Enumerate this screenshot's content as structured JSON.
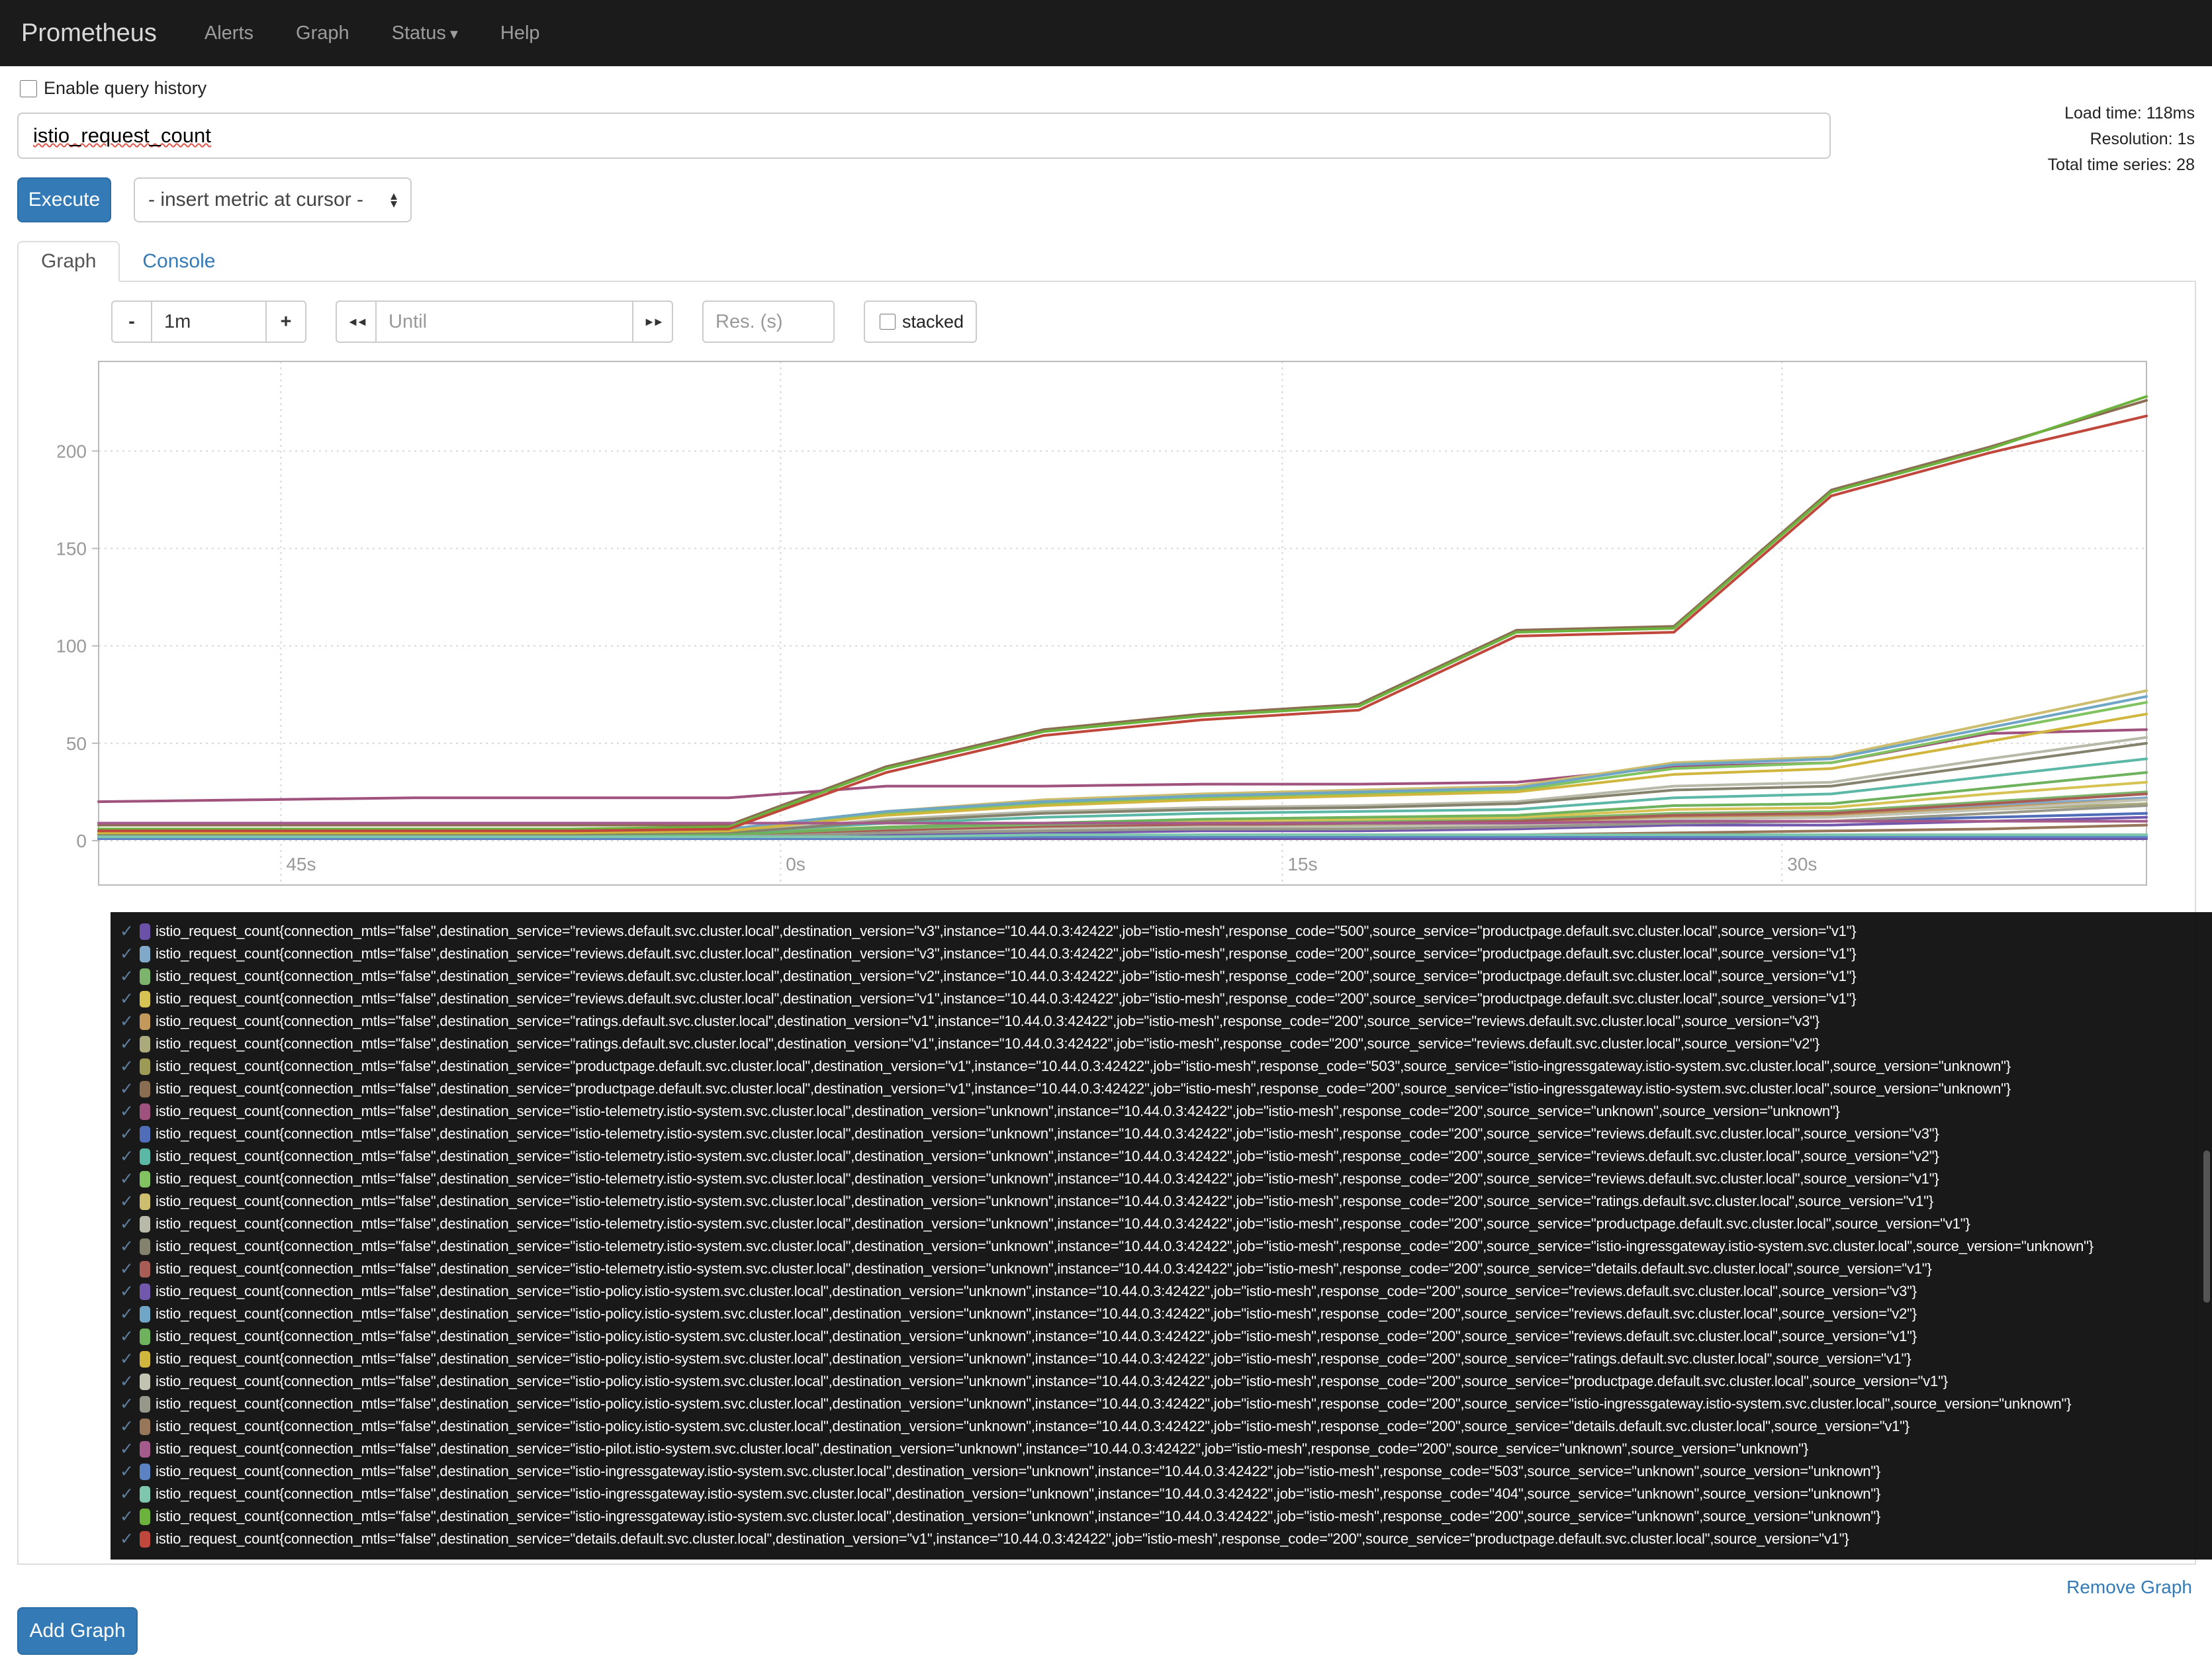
{
  "navbar": {
    "brand": "Prometheus",
    "items": [
      {
        "label": "Alerts"
      },
      {
        "label": "Graph"
      },
      {
        "label": "Status",
        "caret": "▾"
      },
      {
        "label": "Help"
      }
    ]
  },
  "query": {
    "history_label": "Enable query history",
    "expression": "istio_request_count",
    "execute_label": "Execute",
    "metric_select_label": "- insert metric at cursor -",
    "stats": {
      "load_time": "Load time: 118ms",
      "resolution": "Resolution: 1s",
      "total_series": "Total time series: 28"
    }
  },
  "tabs": {
    "graph": "Graph",
    "console": "Console"
  },
  "controls": {
    "minus": "-",
    "duration": "1m",
    "plus": "+",
    "back_icon": "◄◄",
    "until_placeholder": "Until",
    "forward_icon": "►►",
    "res_placeholder": "Res. (s)",
    "stacked_label": "stacked"
  },
  "icons": {
    "check": "✓",
    "select_up": "▴",
    "select_down": "▾"
  },
  "footer": {
    "remove_graph": "Remove Graph",
    "add_graph": "Add Graph"
  },
  "chart_data": {
    "type": "line",
    "x_ticks": [
      {
        "pos": 0.089,
        "label": "45s"
      },
      {
        "pos": 0.333,
        "label": "0s"
      },
      {
        "pos": 0.578,
        "label": "15s"
      },
      {
        "pos": 0.822,
        "label": "30s"
      }
    ],
    "y_ticks": [
      0,
      50,
      100,
      150,
      200
    ],
    "ylim": [
      0,
      246
    ],
    "grid": true,
    "legend_position": "below",
    "series": [
      {
        "name": "reviews-v3-500-from-productpage",
        "color": "#6b51a7",
        "values": [
          1,
          1,
          1,
          1,
          1,
          1,
          1,
          1,
          1,
          1,
          1,
          1,
          1,
          1
        ],
        "label": "istio_request_count{connection_mtls=\"false\",destination_service=\"reviews.default.svc.cluster.local\",destination_version=\"v3\",instance=\"10.44.0.3:42422\",job=\"istio-mesh\",response_code=\"500\",source_service=\"productpage.default.svc.cluster.local\",source_version=\"v1\"}"
      },
      {
        "name": "reviews-v3-200-from-productpage",
        "color": "#7fa8c9",
        "values": [
          2,
          2,
          2,
          2,
          3,
          6,
          7,
          8,
          9,
          10,
          13,
          14,
          18,
          22
        ],
        "label": "istio_request_count{connection_mtls=\"false\",destination_service=\"reviews.default.svc.cluster.local\",destination_version=\"v3\",instance=\"10.44.0.3:42422\",job=\"istio-mesh\",response_code=\"200\",source_service=\"productpage.default.svc.cluster.local\",source_version=\"v1\"}"
      },
      {
        "name": "reviews-v2-200-from-productpage",
        "color": "#7db46c",
        "values": [
          2,
          2,
          2,
          2,
          3,
          6,
          8,
          9,
          10,
          11,
          14,
          15,
          20,
          25
        ],
        "label": "istio_request_count{connection_mtls=\"false\",destination_service=\"reviews.default.svc.cluster.local\",destination_version=\"v2\",instance=\"10.44.0.3:42422\",job=\"istio-mesh\",response_code=\"200\",source_service=\"productpage.default.svc.cluster.local\",source_version=\"v1\"}"
      },
      {
        "name": "reviews-v1-200-from-productpage",
        "color": "#d6c354",
        "values": [
          3,
          3,
          3,
          3,
          4,
          7,
          9,
          10,
          11,
          12,
          16,
          17,
          24,
          30
        ],
        "label": "istio_request_count{connection_mtls=\"false\",destination_service=\"reviews.default.svc.cluster.local\",destination_version=\"v1\",instance=\"10.44.0.3:42422\",job=\"istio-mesh\",response_code=\"200\",source_service=\"productpage.default.svc.cluster.local\",source_version=\"v1\"}"
      },
      {
        "name": "ratings-v1-200-from-reviews-v3",
        "color": "#c2995b",
        "values": [
          2,
          2,
          2,
          2,
          2,
          5,
          7,
          8,
          8,
          9,
          12,
          13,
          17,
          21
        ],
        "label": "istio_request_count{connection_mtls=\"false\",destination_service=\"ratings.default.svc.cluster.local\",destination_version=\"v1\",instance=\"10.44.0.3:42422\",job=\"istio-mesh\",response_code=\"200\",source_service=\"reviews.default.svc.cluster.local\",source_version=\"v3\"}"
      },
      {
        "name": "ratings-v1-200-from-reviews-v2",
        "color": "#abaa7d",
        "values": [
          2,
          2,
          2,
          2,
          2,
          4,
          6,
          7,
          8,
          8,
          11,
          12,
          16,
          19
        ],
        "label": "istio_request_count{connection_mtls=\"false\",destination_service=\"ratings.default.svc.cluster.local\",destination_version=\"v1\",instance=\"10.44.0.3:42422\",job=\"istio-mesh\",response_code=\"200\",source_service=\"reviews.default.svc.cluster.local\",source_version=\"v2\"}"
      },
      {
        "name": "productpage-503-from-ingressgateway",
        "color": "#9c9a55",
        "values": [
          1,
          1,
          1,
          1,
          1,
          2,
          2,
          2,
          2,
          2,
          3,
          3,
          3,
          3
        ],
        "label": "istio_request_count{connection_mtls=\"false\",destination_service=\"productpage.default.svc.cluster.local\",destination_version=\"v1\",instance=\"10.44.0.3:42422\",job=\"istio-mesh\",response_code=\"503\",source_service=\"istio-ingressgateway.istio-system.svc.cluster.local\",source_version=\"unknown\"}"
      },
      {
        "name": "productpage-200-from-ingressgateway",
        "color": "#8b6d51",
        "values": [
          8,
          8,
          8,
          8,
          8,
          38,
          57,
          65,
          70,
          108,
          110,
          180,
          202,
          226
        ],
        "label": "istio_request_count{connection_mtls=\"false\",destination_service=\"productpage.default.svc.cluster.local\",destination_version=\"v1\",instance=\"10.44.0.3:42422\",job=\"istio-mesh\",response_code=\"200\",source_service=\"istio-ingressgateway.istio-system.svc.cluster.local\",source_version=\"unknown\"}"
      },
      {
        "name": "telemetry-200-from-unknown",
        "color": "#a0527e",
        "values": [
          20,
          21,
          22,
          22,
          22,
          28,
          28,
          29,
          29,
          30,
          38,
          40,
          55,
          57
        ],
        "label": "istio_request_count{connection_mtls=\"false\",destination_service=\"istio-telemetry.istio-system.svc.cluster.local\",destination_version=\"unknown\",instance=\"10.44.0.3:42422\",job=\"istio-mesh\",response_code=\"200\",source_service=\"unknown\",source_version=\"unknown\"}"
      },
      {
        "name": "telemetry-200-from-reviews-v3",
        "color": "#4f6db8",
        "values": [
          1,
          1,
          1,
          1,
          2,
          4,
          5,
          6,
          6,
          7,
          9,
          10,
          12,
          14
        ],
        "label": "istio_request_count{connection_mtls=\"false\",destination_service=\"istio-telemetry.istio-system.svc.cluster.local\",destination_version=\"unknown\",instance=\"10.44.0.3:42422\",job=\"istio-mesh\",response_code=\"200\",source_service=\"reviews.default.svc.cluster.local\",source_version=\"v3\"}"
      },
      {
        "name": "telemetry-200-from-reviews-v2",
        "color": "#5cb8a6",
        "values": [
          3,
          3,
          3,
          3,
          4,
          9,
          12,
          14,
          15,
          16,
          22,
          24,
          33,
          42
        ],
        "label": "istio_request_count{connection_mtls=\"false\",destination_service=\"istio-telemetry.istio-system.svc.cluster.local\",destination_version=\"unknown\",instance=\"10.44.0.3:42422\",job=\"istio-mesh\",response_code=\"200\",source_service=\"reviews.default.svc.cluster.local\",source_version=\"v2\"}"
      },
      {
        "name": "telemetry-200-from-reviews-v1",
        "color": "#82c361",
        "values": [
          4,
          4,
          4,
          4,
          5,
          14,
          19,
          22,
          24,
          26,
          37,
          40,
          56,
          71
        ],
        "label": "istio_request_count{connection_mtls=\"false\",destination_service=\"istio-telemetry.istio-system.svc.cluster.local\",destination_version=\"unknown\",instance=\"10.44.0.3:42422\",job=\"istio-mesh\",response_code=\"200\",source_service=\"reviews.default.svc.cluster.local\",source_version=\"v1\"}"
      },
      {
        "name": "telemetry-200-from-ratings-v1",
        "color": "#cdbd6e",
        "values": [
          5,
          5,
          5,
          5,
          6,
          15,
          21,
          24,
          26,
          28,
          40,
          43,
          60,
          77
        ],
        "label": "istio_request_count{connection_mtls=\"false\",destination_service=\"istio-telemetry.istio-system.svc.cluster.local\",destination_version=\"unknown\",instance=\"10.44.0.3:42422\",job=\"istio-mesh\",response_code=\"200\",source_service=\"ratings.default.svc.cluster.local\",source_version=\"v1\"}"
      },
      {
        "name": "telemetry-200-from-productpage-v1",
        "color": "#b9b9aa",
        "values": [
          4,
          4,
          4,
          4,
          4,
          11,
          15,
          17,
          18,
          20,
          28,
          30,
          42,
          53
        ],
        "label": "istio_request_count{connection_mtls=\"false\",destination_service=\"istio-telemetry.istio-system.svc.cluster.local\",destination_version=\"unknown\",instance=\"10.44.0.3:42422\",job=\"istio-mesh\",response_code=\"200\",source_service=\"productpage.default.svc.cluster.local\",source_version=\"v1\"}"
      },
      {
        "name": "telemetry-200-from-ingressgateway",
        "color": "#84826c",
        "values": [
          3,
          3,
          3,
          3,
          4,
          10,
          14,
          16,
          17,
          19,
          26,
          28,
          39,
          50
        ],
        "label": "istio_request_count{connection_mtls=\"false\",destination_service=\"istio-telemetry.istio-system.svc.cluster.local\",destination_version=\"unknown\",instance=\"10.44.0.3:42422\",job=\"istio-mesh\",response_code=\"200\",source_service=\"istio-ingressgateway.istio-system.svc.cluster.local\",source_version=\"unknown\"}"
      },
      {
        "name": "telemetry-200-from-details-v1",
        "color": "#a85c56",
        "values": [
          2,
          2,
          2,
          2,
          2,
          5,
          7,
          8,
          9,
          10,
          13,
          14,
          19,
          24
        ],
        "label": "istio_request_count{connection_mtls=\"false\",destination_service=\"istio-telemetry.istio-system.svc.cluster.local\",destination_version=\"unknown\",instance=\"10.44.0.3:42422\",job=\"istio-mesh\",response_code=\"200\",source_service=\"details.default.svc.cluster.local\",source_version=\"v1\"}"
      },
      {
        "name": "policy-200-from-reviews-v3",
        "color": "#7258ad",
        "values": [
          1,
          1,
          1,
          1,
          1,
          3,
          4,
          5,
          5,
          6,
          8,
          8,
          10,
          12
        ],
        "label": "istio_request_count{connection_mtls=\"false\",destination_service=\"istio-policy.istio-system.svc.cluster.local\",destination_version=\"unknown\",instance=\"10.44.0.3:42422\",job=\"istio-mesh\",response_code=\"200\",source_service=\"reviews.default.svc.cluster.local\",source_version=\"v3\"}"
      },
      {
        "name": "policy-200-from-reviews-v2",
        "color": "#6fa6c6",
        "values": [
          5,
          5,
          5,
          5,
          6,
          15,
          20,
          23,
          25,
          27,
          39,
          42,
          58,
          74
        ],
        "label": "istio_request_count{connection_mtls=\"false\",destination_service=\"istio-policy.istio-system.svc.cluster.local\",destination_version=\"unknown\",instance=\"10.44.0.3:42422\",job=\"istio-mesh\",response_code=\"200\",source_service=\"reviews.default.svc.cluster.local\",source_version=\"v2\"}"
      },
      {
        "name": "policy-200-from-reviews-v1",
        "color": "#6fb25e",
        "values": [
          2,
          2,
          2,
          2,
          3,
          7,
          9,
          11,
          12,
          13,
          18,
          19,
          27,
          35
        ],
        "label": "istio_request_count{connection_mtls=\"false\",destination_service=\"istio-policy.istio-system.svc.cluster.local\",destination_version=\"unknown\",instance=\"10.44.0.3:42422\",job=\"istio-mesh\",response_code=\"200\",source_service=\"reviews.default.svc.cluster.local\",source_version=\"v1\"}"
      },
      {
        "name": "policy-200-from-ratings-v1",
        "color": "#d1b63e",
        "values": [
          4,
          4,
          4,
          4,
          5,
          13,
          18,
          21,
          23,
          25,
          34,
          37,
          51,
          65
        ],
        "label": "istio_request_count{connection_mtls=\"false\",destination_service=\"istio-policy.istio-system.svc.cluster.local\",destination_version=\"unknown\",instance=\"10.44.0.3:42422\",job=\"istio-mesh\",response_code=\"200\",source_service=\"ratings.default.svc.cluster.local\",source_version=\"v1\"}"
      },
      {
        "name": "policy-200-from-productpage-v1",
        "color": "#c3c3b4",
        "values": [
          1,
          1,
          1,
          1,
          2,
          4,
          6,
          7,
          7,
          8,
          11,
          12,
          16,
          21
        ],
        "label": "istio_request_count{connection_mtls=\"false\",destination_service=\"istio-policy.istio-system.svc.cluster.local\",destination_version=\"unknown\",instance=\"10.44.0.3:42422\",job=\"istio-mesh\",response_code=\"200\",source_service=\"productpage.default.svc.cluster.local\",source_version=\"v1\"}"
      },
      {
        "name": "policy-200-from-ingressgateway",
        "color": "#98988a",
        "values": [
          1,
          1,
          1,
          1,
          2,
          4,
          5,
          6,
          6,
          7,
          9,
          10,
          14,
          18
        ],
        "label": "istio_request_count{connection_mtls=\"false\",destination_service=\"istio-policy.istio-system.svc.cluster.local\",destination_version=\"unknown\",instance=\"10.44.0.3:42422\",job=\"istio-mesh\",response_code=\"200\",source_service=\"istio-ingressgateway.istio-system.svc.cluster.local\",source_version=\"unknown\"}"
      },
      {
        "name": "policy-200-from-details-v1",
        "color": "#97765a",
        "values": [
          1,
          1,
          1,
          1,
          1,
          2,
          2,
          3,
          3,
          3,
          4,
          5,
          6,
          8
        ],
        "label": "istio_request_count{connection_mtls=\"false\",destination_service=\"istio-policy.istio-system.svc.cluster.local\",destination_version=\"unknown\",instance=\"10.44.0.3:42422\",job=\"istio-mesh\",response_code=\"200\",source_service=\"details.default.svc.cluster.local\",source_version=\"v1\"}"
      },
      {
        "name": "pilot-200-from-unknown",
        "color": "#a45a8a",
        "values": [
          9,
          9,
          9,
          9,
          9,
          9,
          9,
          9,
          9,
          9,
          10,
          10,
          10,
          10
        ],
        "label": "istio_request_count{connection_mtls=\"false\",destination_service=\"istio-pilot.istio-system.svc.cluster.local\",destination_version=\"unknown\",instance=\"10.44.0.3:42422\",job=\"istio-mesh\",response_code=\"200\",source_service=\"unknown\",source_version=\"unknown\"}"
      },
      {
        "name": "ingressgateway-503-from-unknown",
        "color": "#5b83c4",
        "values": [
          1,
          1,
          1,
          1,
          1,
          1,
          2,
          2,
          2,
          2,
          2,
          2,
          2,
          2
        ],
        "label": "istio_request_count{connection_mtls=\"false\",destination_service=\"istio-ingressgateway.istio-system.svc.cluster.local\",destination_version=\"unknown\",instance=\"10.44.0.3:42422\",job=\"istio-mesh\",response_code=\"503\",source_service=\"unknown\",source_version=\"unknown\"}"
      },
      {
        "name": "ingressgateway-404-from-unknown",
        "color": "#7ec7ae",
        "values": [
          2,
          2,
          2,
          2,
          2,
          2,
          3,
          3,
          3,
          3,
          3,
          3,
          3,
          3
        ],
        "label": "istio_request_count{connection_mtls=\"false\",destination_service=\"istio-ingressgateway.istio-system.svc.cluster.local\",destination_version=\"unknown\",instance=\"10.44.0.3:42422\",job=\"istio-mesh\",response_code=\"404\",source_service=\"unknown\",source_version=\"unknown\"}"
      },
      {
        "name": "ingressgateway-200-from-unknown",
        "color": "#6cb33e",
        "values": [
          6,
          6,
          6,
          6,
          7,
          37,
          56,
          64,
          69,
          107,
          109,
          179,
          201,
          228
        ],
        "label": "istio_request_count{connection_mtls=\"false\",destination_service=\"istio-ingressgateway.istio-system.svc.cluster.local\",destination_version=\"unknown\",instance=\"10.44.0.3:42422\",job=\"istio-mesh\",response_code=\"200\",source_service=\"unknown\",source_version=\"unknown\"}"
      },
      {
        "name": "details-v1-200-from-productpage",
        "color": "#c0473b",
        "values": [
          5,
          5,
          5,
          5,
          6,
          35,
          54,
          62,
          67,
          105,
          107,
          177,
          199,
          218
        ],
        "label": "istio_request_count{connection_mtls=\"false\",destination_service=\"details.default.svc.cluster.local\",destination_version=\"v1\",instance=\"10.44.0.3:42422\",job=\"istio-mesh\",response_code=\"200\",source_service=\"productpage.default.svc.cluster.local\",source_version=\"v1\"}"
      }
    ]
  }
}
